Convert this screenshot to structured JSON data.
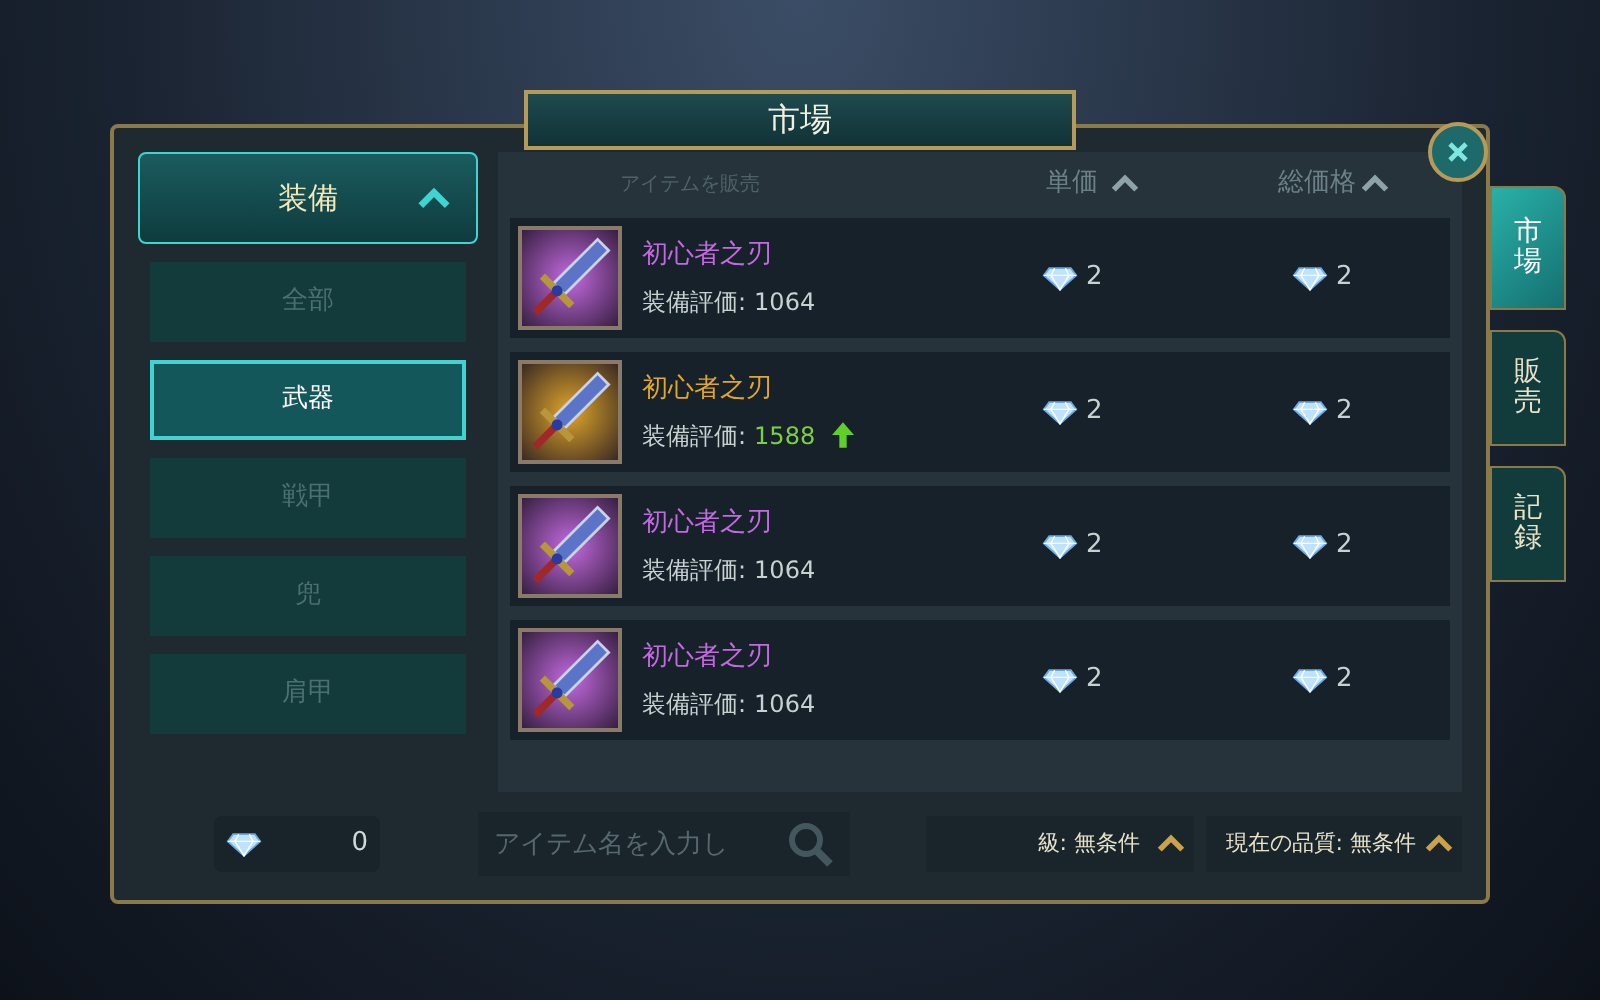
{
  "window": {
    "title": "市場"
  },
  "side_tabs": [
    {
      "label": "市場",
      "selected": true
    },
    {
      "label": "販売",
      "selected": false
    },
    {
      "label": "記録",
      "selected": false
    }
  ],
  "category": {
    "label": "装備",
    "expanded": true
  },
  "subcategories": [
    {
      "label": "全部",
      "selected": false
    },
    {
      "label": "武器",
      "selected": true
    },
    {
      "label": "戦甲",
      "selected": false
    },
    {
      "label": "兜",
      "selected": false
    },
    {
      "label": "肩甲",
      "selected": false
    }
  ],
  "table": {
    "columns": [
      {
        "label": "アイテムを販売",
        "sortable": false
      },
      {
        "label": "単価",
        "sortable": true
      },
      {
        "label": "総価格",
        "sortable": true
      }
    ],
    "rows": [
      {
        "name": "初心者之刃",
        "color": "#c46ae0",
        "score_label": "装備評価:",
        "score": "1064",
        "upgrade": false,
        "unit_price": "2",
        "total_price": "2"
      },
      {
        "name": "初心者之刃",
        "color": "#e0a72a",
        "score_label": "装備評価:",
        "score": "1588",
        "upgrade": true,
        "unit_price": "2",
        "total_price": "2"
      },
      {
        "name": "初心者之刃",
        "color": "#c46ae0",
        "score_label": "装備評価:",
        "score": "1064",
        "upgrade": false,
        "unit_price": "2",
        "total_price": "2"
      },
      {
        "name": "初心者之刃",
        "color": "#c46ae0",
        "score_label": "装備評価:",
        "score": "1064",
        "upgrade": false,
        "unit_price": "2",
        "total_price": "2"
      }
    ]
  },
  "balance": "0",
  "search": {
    "placeholder": "アイテム名を入力し"
  },
  "filters": [
    {
      "label": "級: 無条件"
    },
    {
      "label": "現在の品質: 無条件"
    }
  ]
}
